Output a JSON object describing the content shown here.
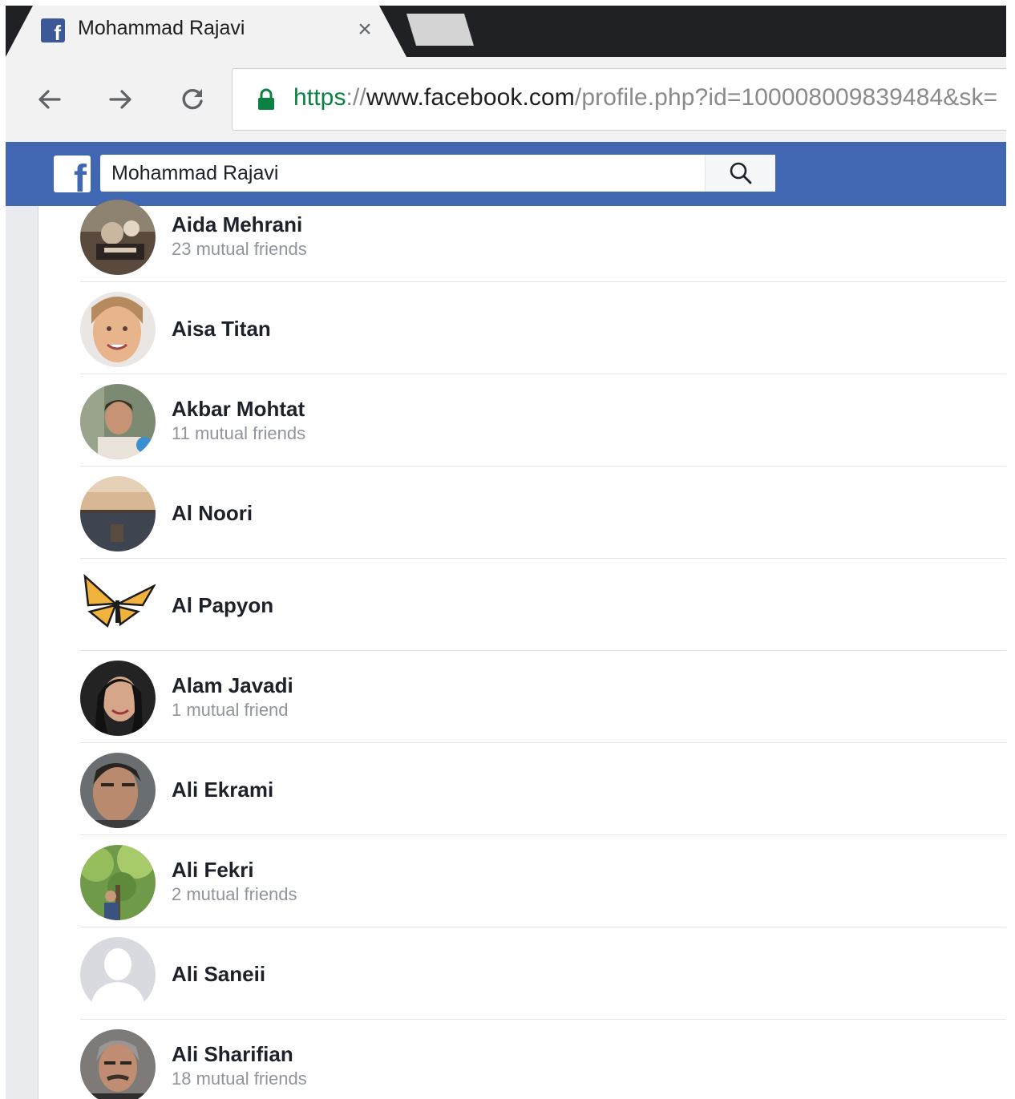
{
  "browser": {
    "tab": {
      "title": "Mohammad Rajavi",
      "favicon": "facebook-favicon"
    },
    "address_bar": {
      "scheme": "https",
      "separator": "://",
      "host": "www.facebook.com",
      "path": "/profile.php?id=100008009839484&sk="
    },
    "lock_color": "#0b8043"
  },
  "facebook": {
    "brand_color": "#4267b2",
    "logo_letter": "f",
    "search": {
      "value": "Mohammad Rajavi",
      "icon": "search-icon"
    }
  },
  "friends": [
    {
      "name": "Aida Mehrani",
      "mutual": "23 mutual friends"
    },
    {
      "name": "Aisa Titan",
      "mutual": ""
    },
    {
      "name": "Akbar Mohtat",
      "mutual": "11 mutual friends"
    },
    {
      "name": "Al Noori",
      "mutual": ""
    },
    {
      "name": "Al Papyon",
      "mutual": ""
    },
    {
      "name": "Alam Javadi",
      "mutual": "1 mutual friend"
    },
    {
      "name": "Ali Ekrami",
      "mutual": ""
    },
    {
      "name": "Ali Fekri",
      "mutual": "2 mutual friends"
    },
    {
      "name": "Ali Saneii",
      "mutual": ""
    },
    {
      "name": "Ali Sharifian",
      "mutual": "18 mutual friends"
    }
  ]
}
